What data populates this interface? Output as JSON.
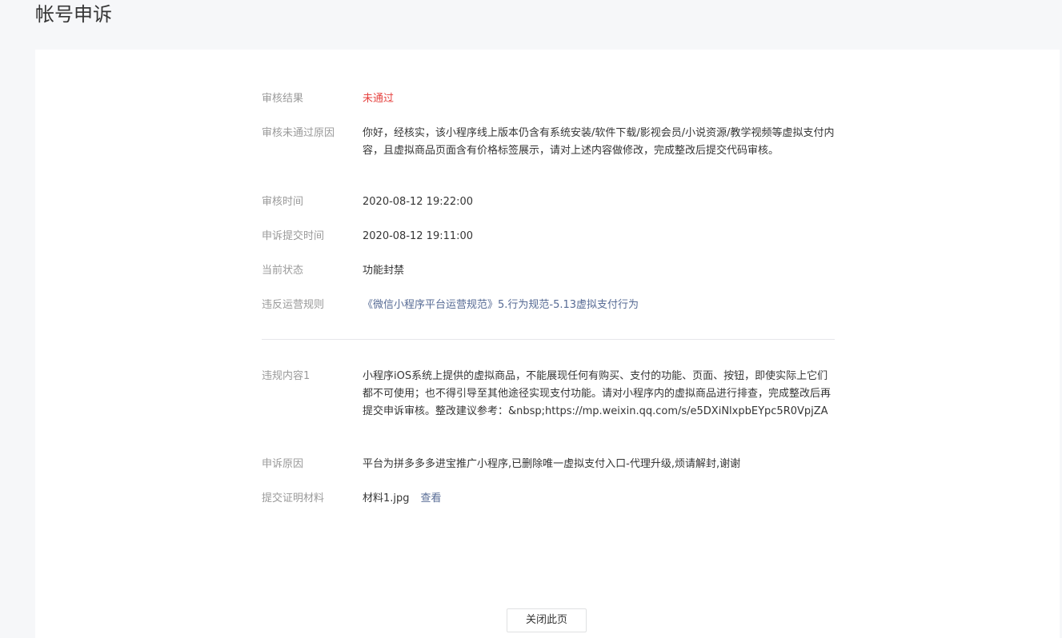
{
  "page": {
    "title": "帐号申诉"
  },
  "review": {
    "result_label": "审核结果",
    "result_value": "未通过",
    "reason_label": "审核未通过原因",
    "reason_value": "你好，经核实，该小程序线上版本仍含有系统安装/软件下载/影视会员/小说资源/教学视频等虚拟支付内容，且虚拟商品页面含有价格标签展示，请对上述内容做修改，完成整改后提交代码审核。",
    "time_label": "审核时间",
    "time_value": "2020-08-12 19:22:00",
    "submit_time_label": "申诉提交时间",
    "submit_time_value": "2020-08-12 19:11:00",
    "status_label": "当前状态",
    "status_value": "功能封禁",
    "rule_label": "违反运营规则",
    "rule_value": "《微信小程序平台运营规范》5.行为规范-5.13虚拟支付行为"
  },
  "violation": {
    "content_label": "违规内容1",
    "content_value": "小程序iOS系统上提供的虚拟商品，不能展现任何有购买、支付的功能、页面、按钮，即使实际上它们都不可使用；也不得引导至其他途径实现支付功能。请对小程序内的虚拟商品进行排查，完成整改后再提交申诉审核。整改建议参考：&nbsp;https://mp.weixin.qq.com/s/e5DXiNlxpbEYpc5R0VpjZA",
    "appeal_reason_label": "申诉原因",
    "appeal_reason_value": "平台为拼多多多进宝推广小程序,已删除唯一虚拟支付入口-代理升级,烦请解封,谢谢",
    "evidence_label": "提交证明材料",
    "evidence_file": "材料1.jpg",
    "evidence_view": "查看"
  },
  "footer": {
    "close_label": "关闭此页"
  }
}
